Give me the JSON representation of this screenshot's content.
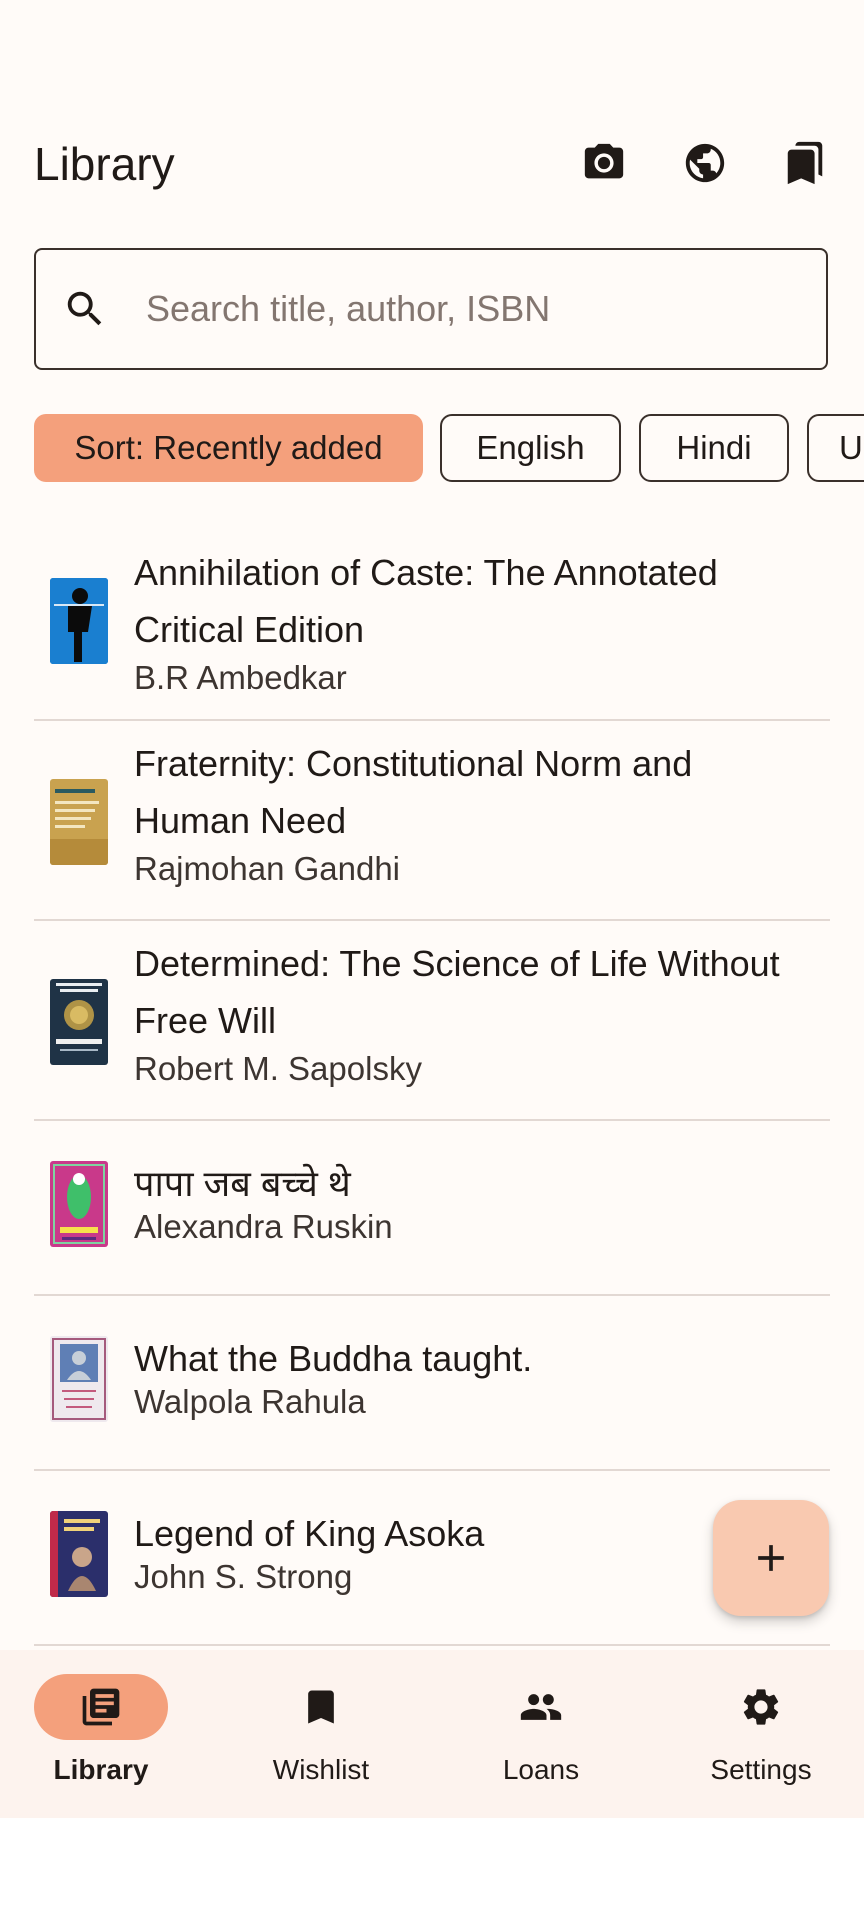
{
  "app_bar": {
    "title": "Library",
    "icons": [
      "camera-icon",
      "globe-icon",
      "bookmarks-icon"
    ]
  },
  "search": {
    "placeholder": "Search title, author, ISBN",
    "value": ""
  },
  "chips": [
    {
      "label": "Sort: Recently added",
      "selected": true
    },
    {
      "label": "English",
      "selected": false
    },
    {
      "label": "Hindi",
      "selected": false
    },
    {
      "label": "Urdu",
      "selected": false
    }
  ],
  "books": [
    {
      "title": "Annihilation of Caste: The Annotated Critical Edition",
      "author": "B.R Ambedkar"
    },
    {
      "title": "Fraternity: Constitutional Norm and Human Need",
      "author": "Rajmohan Gandhi"
    },
    {
      "title": "Determined: The Science of Life Without Free Will",
      "author": "Robert M. Sapolsky"
    },
    {
      "title": "पापा जब बच्चे थे",
      "author": "Alexandra Ruskin"
    },
    {
      "title": "What the Buddha taught.",
      "author": "Walpola Rahula"
    },
    {
      "title": "Legend of King Asoka",
      "author": "John S. Strong"
    }
  ],
  "fab": {
    "icon": "plus-icon"
  },
  "bottom_nav": [
    {
      "label": "Library",
      "icon": "library-icon",
      "active": true
    },
    {
      "label": "Wishlist",
      "icon": "bookmark-icon",
      "active": false
    },
    {
      "label": "Loans",
      "icon": "people-icon",
      "active": false
    },
    {
      "label": "Settings",
      "icon": "gear-icon",
      "active": false
    }
  ],
  "colors": {
    "background": "#fffbf8",
    "accent": "#f4a07c",
    "fab": "#f9c9b0",
    "nav_background": "#fdf3ee"
  }
}
